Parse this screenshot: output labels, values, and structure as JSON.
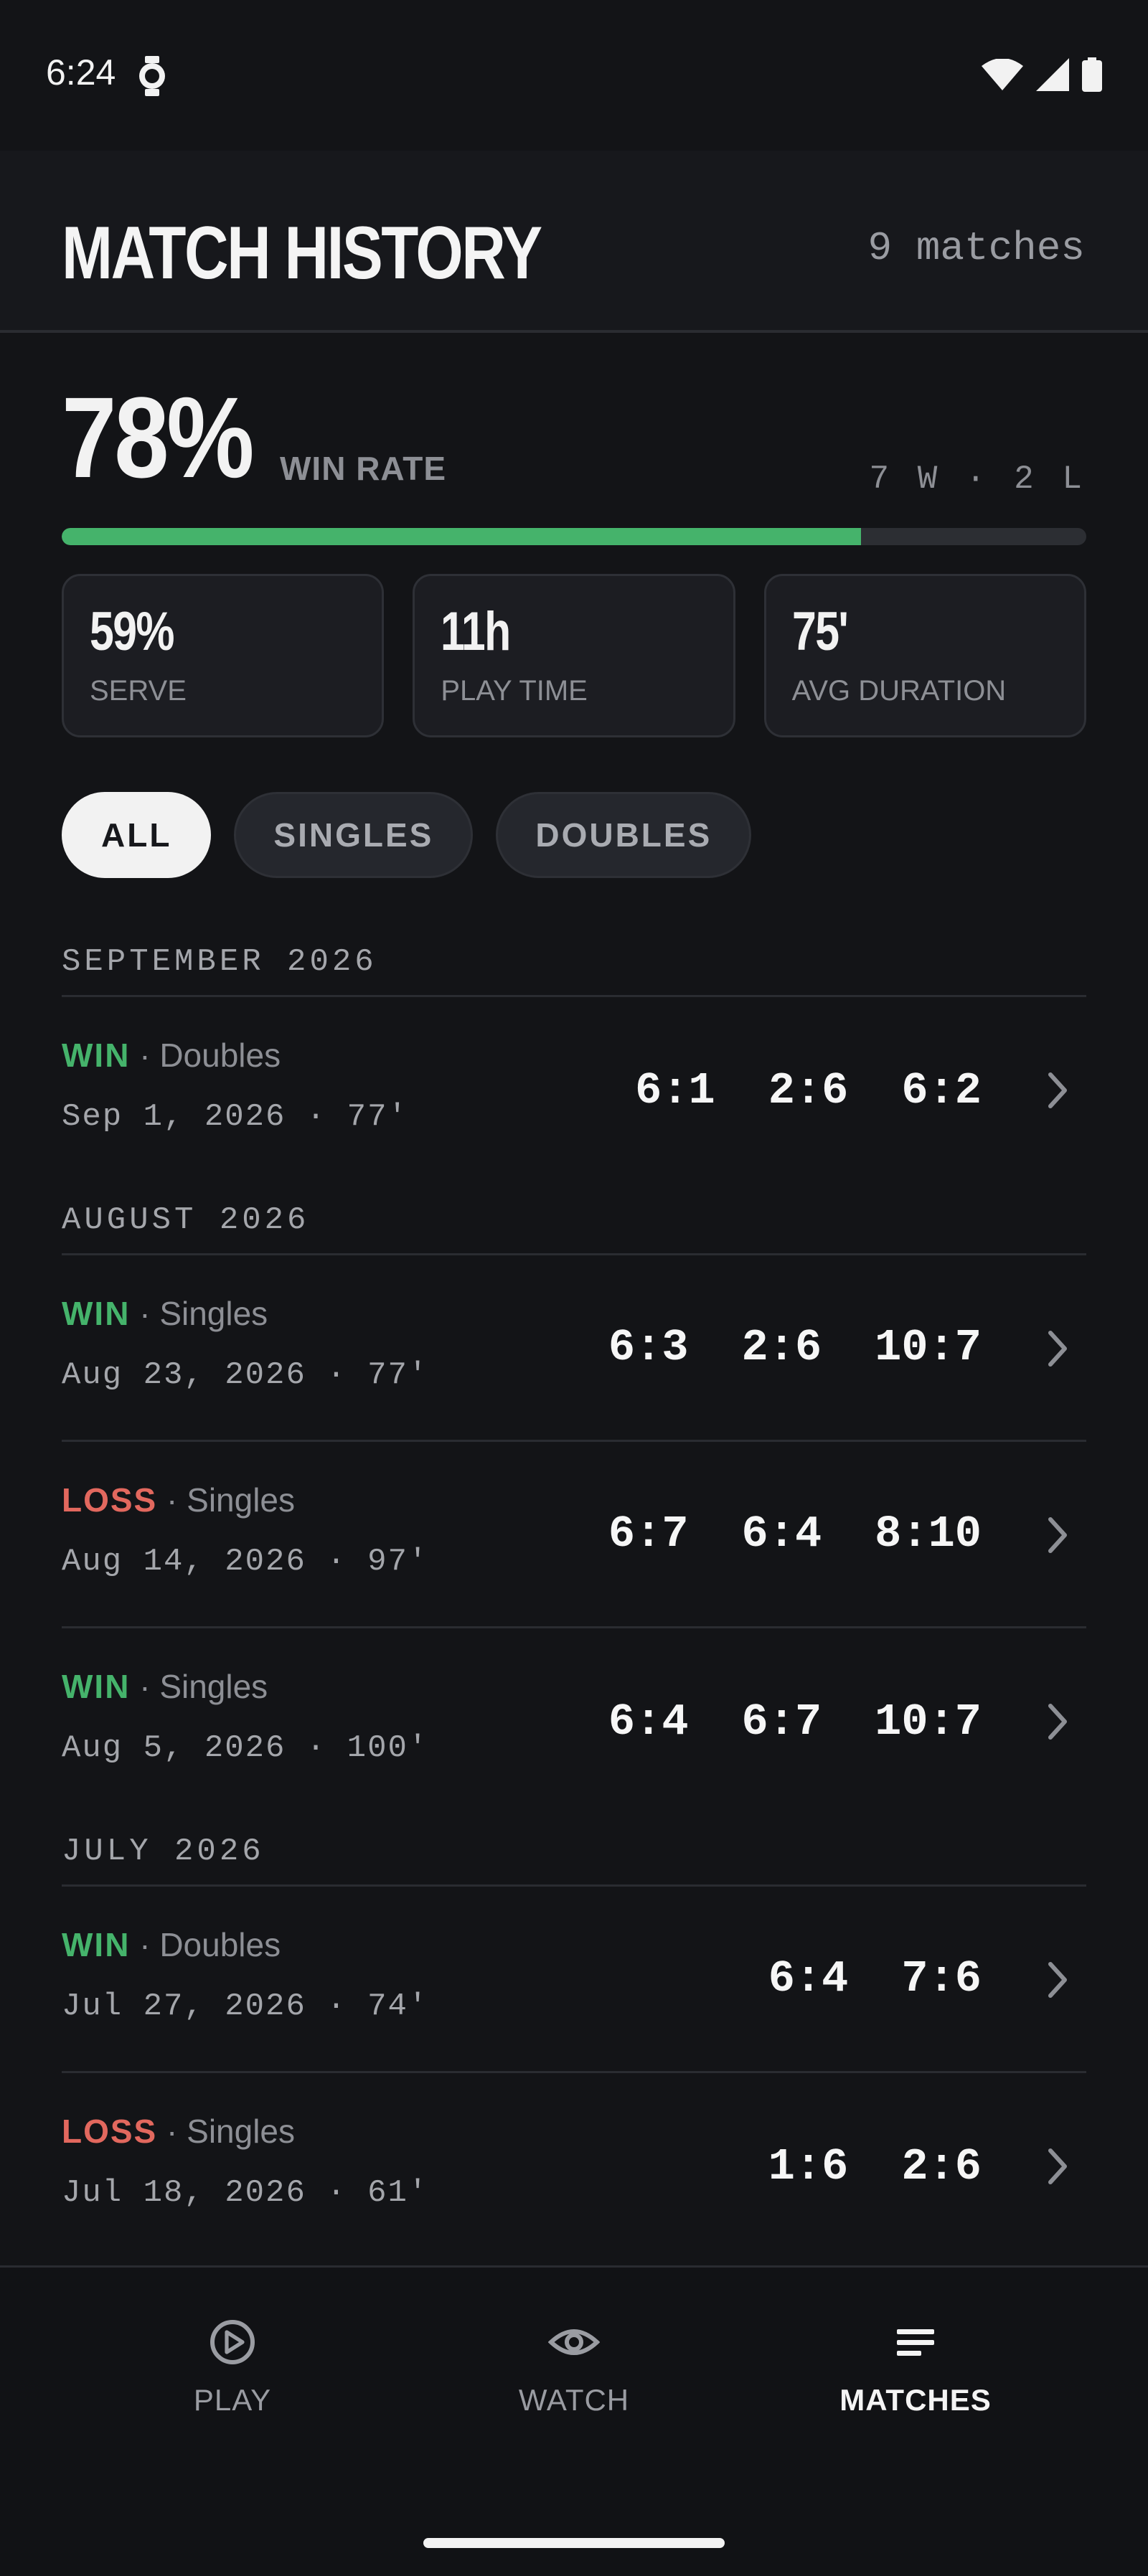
{
  "status": {
    "time": "6:24"
  },
  "header": {
    "title": "MATCH HISTORY",
    "count": "9 matches"
  },
  "summary": {
    "win_rate": "78%",
    "win_rate_label": "WIN RATE",
    "record": "7 W · 2 L",
    "win_fraction": 0.78
  },
  "stats": [
    {
      "value": "59%",
      "label": "SERVE"
    },
    {
      "value": "11h",
      "label": "PLAY TIME"
    },
    {
      "value": "75'",
      "label": "AVG DURATION"
    }
  ],
  "filters": [
    {
      "label": "ALL",
      "active": true
    },
    {
      "label": "SINGLES",
      "active": false
    },
    {
      "label": "DOUBLES",
      "active": false
    }
  ],
  "sections": [
    {
      "title": "SEPTEMBER 2026",
      "matches": [
        {
          "result": "WIN",
          "type": "Doubles",
          "date": "Sep 1, 2026 · 77'",
          "sets": [
            "6:1",
            "2:6",
            "6:2"
          ]
        }
      ]
    },
    {
      "title": "AUGUST 2026",
      "matches": [
        {
          "result": "WIN",
          "type": "Singles",
          "date": "Aug 23, 2026 · 77'",
          "sets": [
            "6:3",
            "2:6",
            "10:7"
          ]
        },
        {
          "result": "LOSS",
          "type": "Singles",
          "date": "Aug 14, 2026 · 97'",
          "sets": [
            "6:7",
            "6:4",
            "8:10"
          ]
        },
        {
          "result": "WIN",
          "type": "Singles",
          "date": "Aug 5, 2026 · 100'",
          "sets": [
            "6:4",
            "6:7",
            "10:7"
          ]
        }
      ]
    },
    {
      "title": "JULY 2026",
      "matches": [
        {
          "result": "WIN",
          "type": "Doubles",
          "date": "Jul 27, 2026 · 74'",
          "sets": [
            "6:4",
            "7:6"
          ]
        },
        {
          "result": "LOSS",
          "type": "Singles",
          "date": "Jul 18, 2026 · 61'",
          "sets": [
            "1:6",
            "2:6"
          ]
        }
      ]
    }
  ],
  "nav": [
    {
      "label": "PLAY",
      "icon": "play-circle-icon",
      "active": false
    },
    {
      "label": "WATCH",
      "icon": "eye-icon",
      "active": false
    },
    {
      "label": "MATCHES",
      "icon": "list-icon",
      "active": true
    }
  ],
  "colors": {
    "win": "#45b36b",
    "loss": "#e2685e",
    "background": "#131417"
  }
}
